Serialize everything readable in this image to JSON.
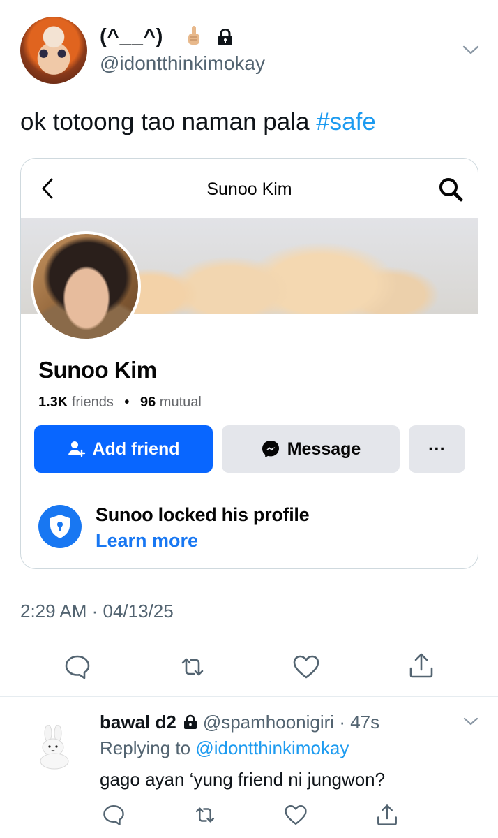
{
  "tweet": {
    "author_name": "(^__^)",
    "author_handle": "@idontthinkimokay",
    "text": "ok totoong tao naman pala ",
    "hashtag": "#safe",
    "timestamp": "2:29 AM · 04/13/25"
  },
  "card": {
    "title": "Sunoo Kim",
    "profile_name": "Sunoo Kim",
    "friends_count": "1.3K",
    "friends_label": "friends",
    "mutual_count": "96",
    "mutual_label": "mutual",
    "add_friend_label": "Add friend",
    "message_label": "Message",
    "more_label": "···",
    "locked_text": "Sunoo locked his profile",
    "learn_more_label": "Learn more"
  },
  "reply": {
    "name": "bawal d2",
    "handle": "@spamhoonigiri",
    "age": "47s",
    "replying_prefix": "Replying to ",
    "replying_handle": "@idontthinkimokay",
    "text": "gago ayan ‘yung friend ni jungwon?"
  },
  "colors": {
    "accent_blue": "#1d9bf0",
    "facebook_blue": "#0866ff",
    "secondary_text": "#536471"
  },
  "icons": [
    "pointing-finger-emoji",
    "lock-icon",
    "chevron-down-icon",
    "back-icon",
    "search-icon",
    "add-person-icon",
    "messenger-icon",
    "shield-lock-icon",
    "reply-icon",
    "retweet-icon",
    "like-icon",
    "share-icon"
  ]
}
